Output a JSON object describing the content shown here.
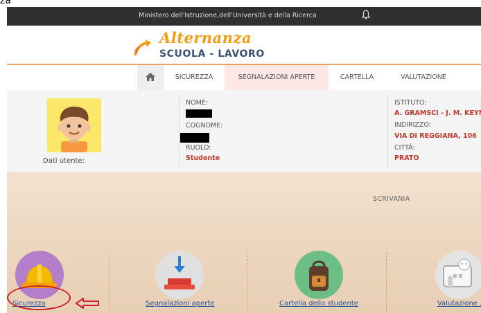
{
  "corner_text": "za",
  "topbar": {
    "title": "Ministero dell'Istruzione,dell'Università e della Ricerca",
    "icon": "bell-icon"
  },
  "logo": {
    "script": "Alternanza",
    "sub": "SCUOLA - LAVORO"
  },
  "nav": {
    "home_icon": "home-icon",
    "items": [
      "SICUREZZA",
      "SEGNALAZIONI APERTE",
      "CARTELLA",
      "VALUTAZIONE"
    ],
    "active_color": "#fde8e6"
  },
  "user": {
    "caption": "Dati utente:",
    "nome_label": "NOME:",
    "cognome_label": "COGNOME:",
    "ruolo_label": "RUOLO:",
    "ruolo_value": "Studente",
    "istituto_label": "ISTITUTO:",
    "istituto_value": "A. GRAMSCI - J. M. KEYNE",
    "indirizzo_label": "INDIRIZZO:",
    "indirizzo_value": "VIA DI REGGIANA, 106",
    "citta_label": "CITTÀ:",
    "citta_value": "PRATO"
  },
  "desk": {
    "title": "SCRIVANIA",
    "links": [
      "Sicurezza",
      "Segnalazioni aperte",
      "Cartella dello studente",
      "Valutazione ."
    ]
  },
  "colors": {
    "accent": "#f39c12",
    "highlight": "#d0202a",
    "value_red": "#c0392b",
    "link": "#1f4f9a"
  }
}
